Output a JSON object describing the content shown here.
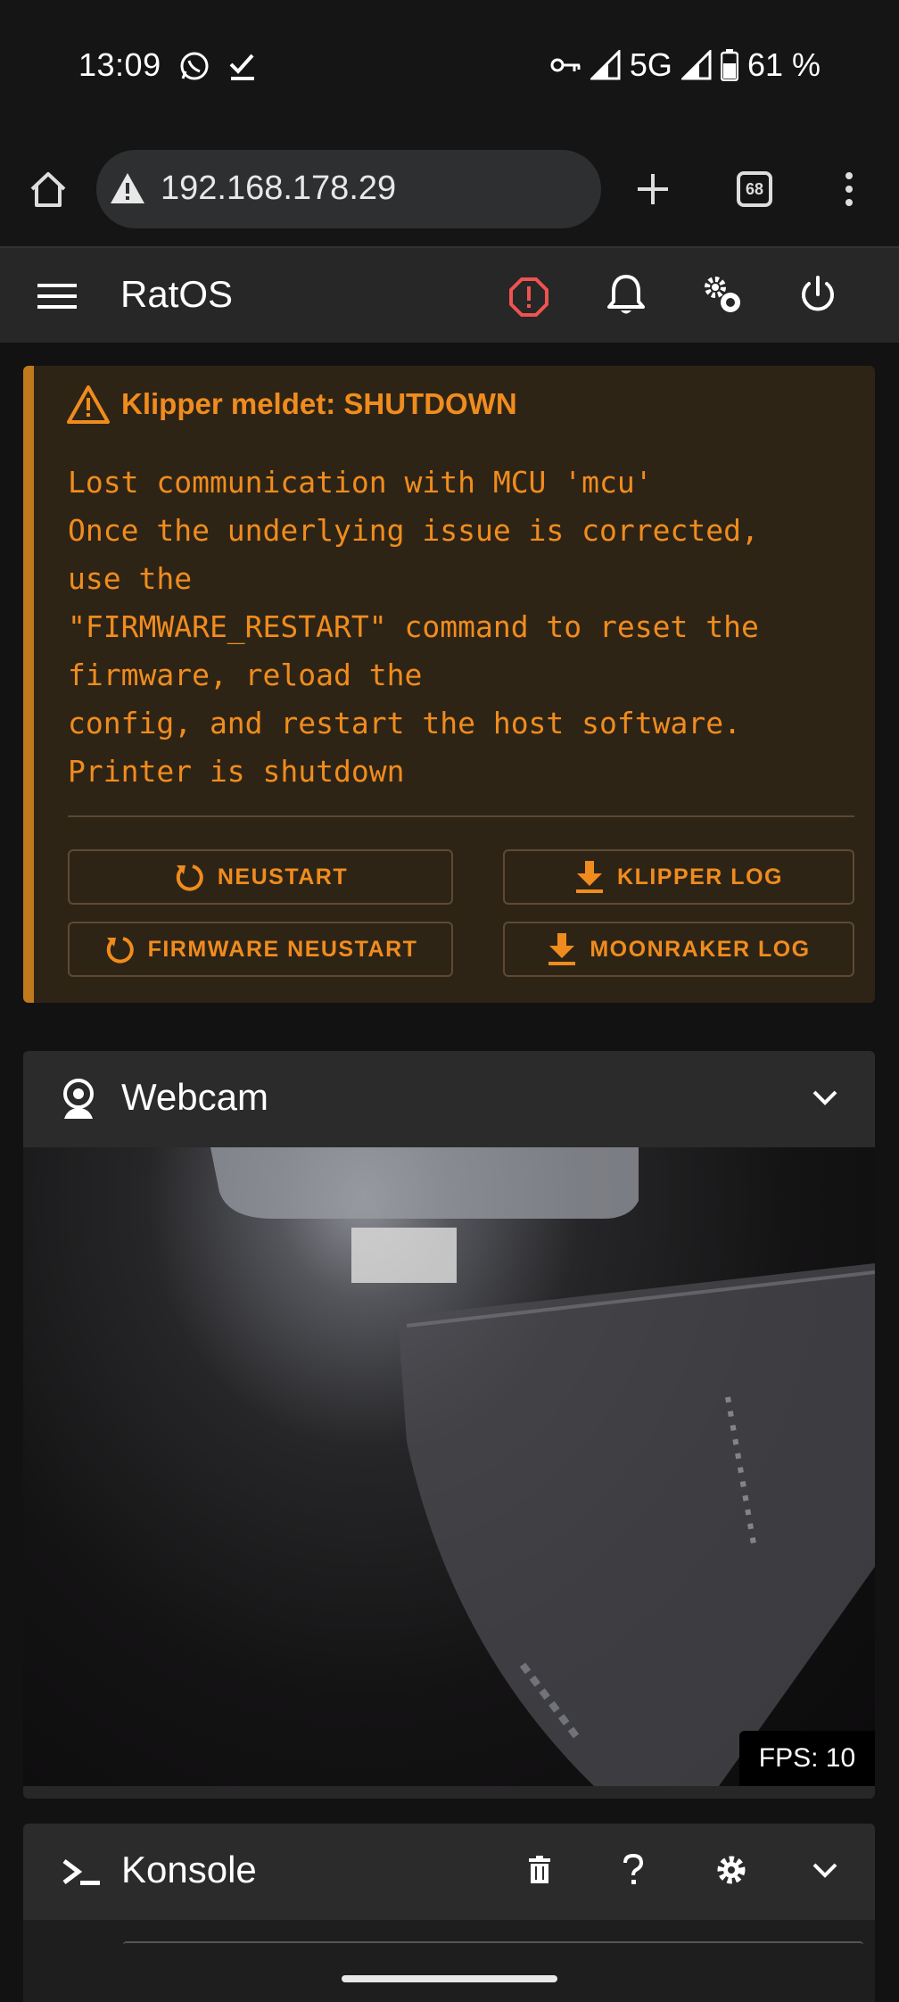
{
  "status_bar": {
    "time": "13:09",
    "network": "5G",
    "battery": "61 %"
  },
  "browser": {
    "url": "192.168.178.29",
    "tab_count": "68"
  },
  "app": {
    "title": "RatOS"
  },
  "alert": {
    "heading": "Klipper meldet: SHUTDOWN",
    "message": "Lost communication with MCU 'mcu'\nOnce the underlying issue is corrected,\nuse the\n\"FIRMWARE_RESTART\" command to reset the\nfirmware, reload the\nconfig, and restart the host software.\nPrinter is shutdown",
    "buttons": {
      "restart": "NEUSTART",
      "klipper_log": "KLIPPER LOG",
      "firmware_restart": "FIRMWARE NEUSTART",
      "moonraker_log": "MOONRAKER LOG"
    }
  },
  "webcam": {
    "title": "Webcam",
    "fps": "FPS: 10"
  },
  "console": {
    "title": "Konsole"
  },
  "colors": {
    "accent": "#f08c1e",
    "error": "#ef5350",
    "panel": "#272727"
  }
}
